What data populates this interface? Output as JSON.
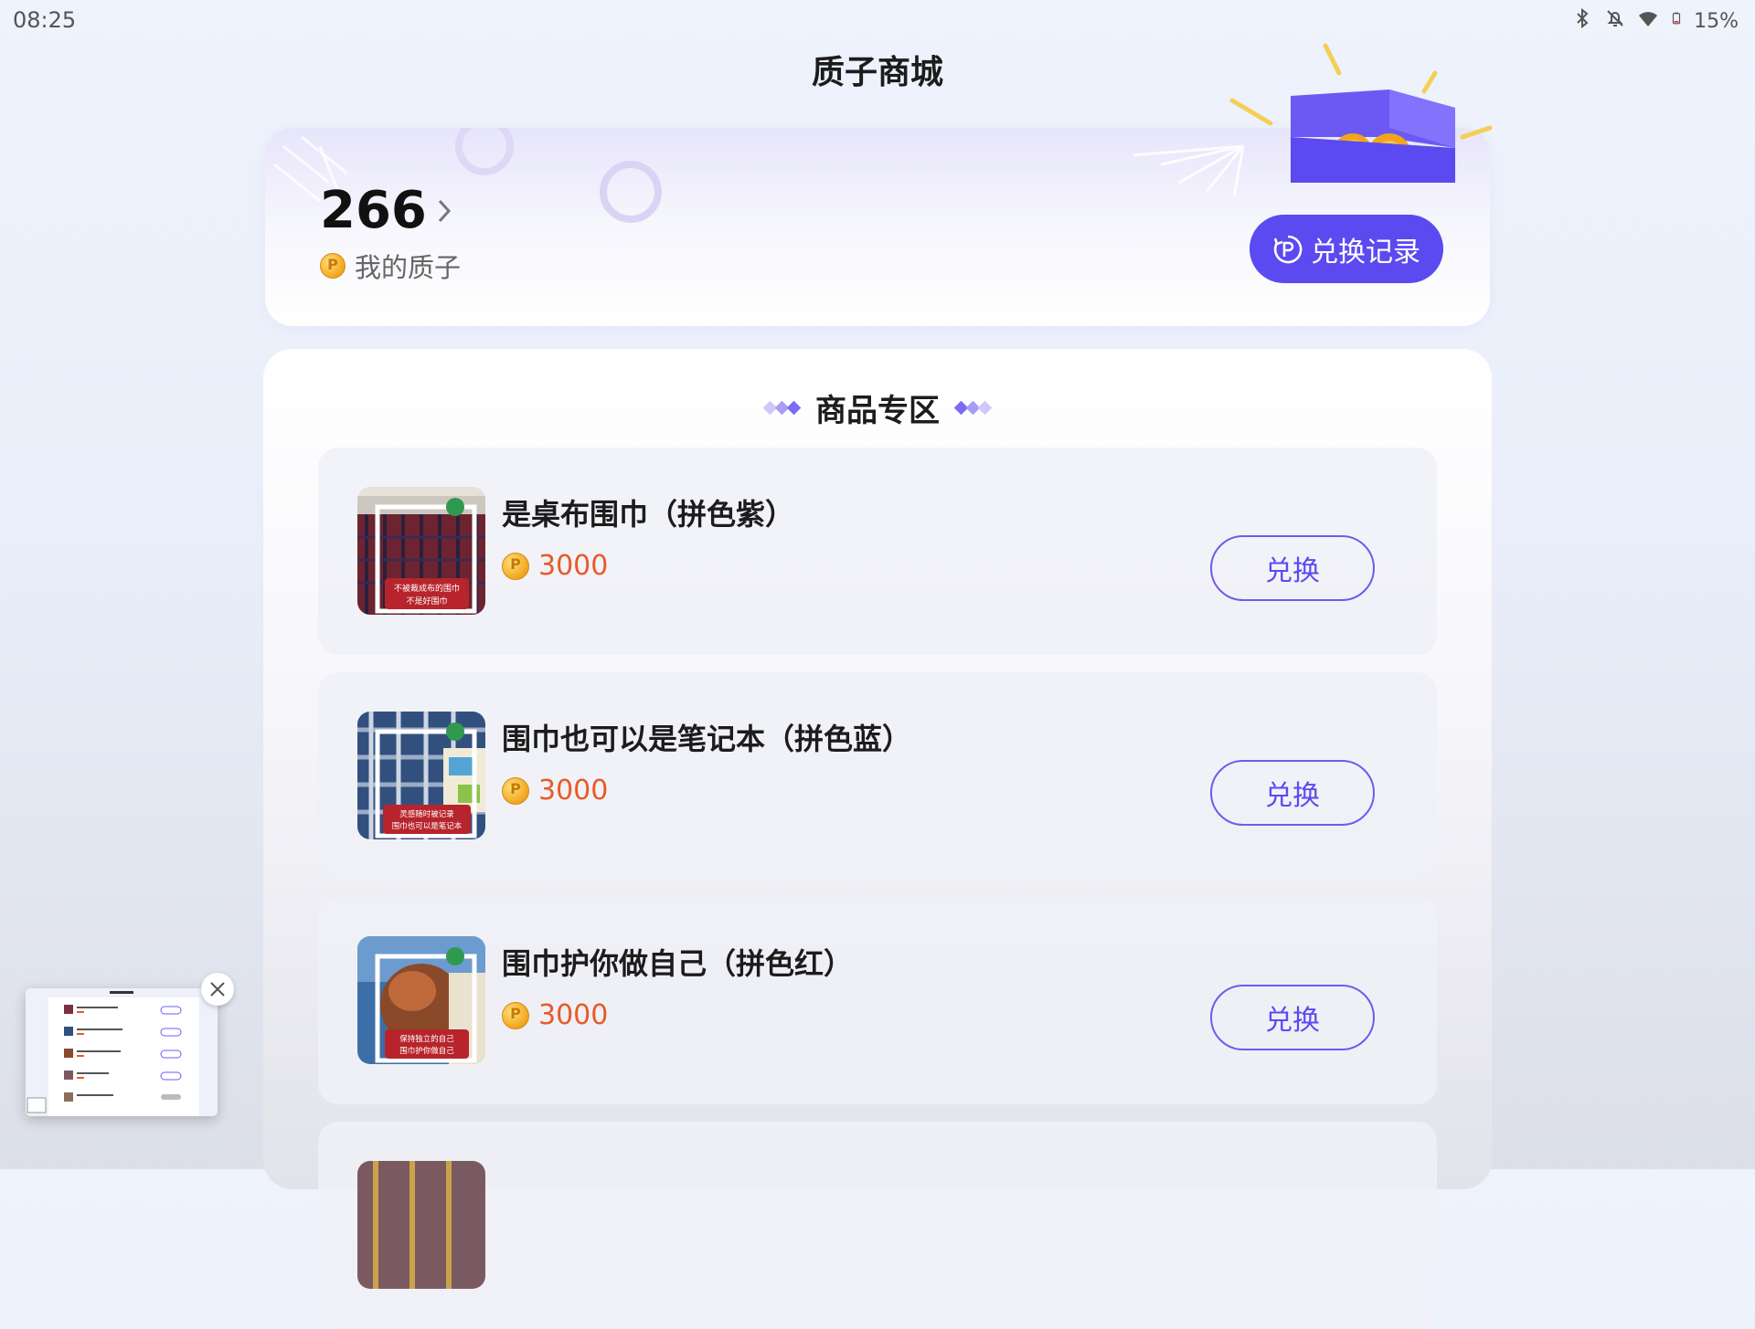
{
  "status_bar": {
    "time": "08:25",
    "battery": "15%"
  },
  "page": {
    "title": "质子商城"
  },
  "balance": {
    "value": "266",
    "label": "我的质子",
    "records_label": "兑换记录"
  },
  "section": {
    "title": "商品专区"
  },
  "products": [
    {
      "name": "是桌布围巾（拼色紫）",
      "price": "3000",
      "button": "兑换",
      "thumb_caption_1": "不被裁成布的围巾",
      "thumb_caption_2": "不是好围巾"
    },
    {
      "name": "围巾也可以是笔记本（拼色蓝）",
      "price": "3000",
      "button": "兑换",
      "thumb_caption_1": "灵感随时被记录",
      "thumb_caption_2": "围巾也可以是笔记本"
    },
    {
      "name": "围巾护你做自己（拼色红）",
      "price": "3000",
      "button": "兑换",
      "thumb_caption_1": "保持独立的自己",
      "thumb_caption_2": "围巾护你做自己"
    }
  ],
  "colors": {
    "accent": "#5b4af0",
    "price": "#e85a28"
  }
}
